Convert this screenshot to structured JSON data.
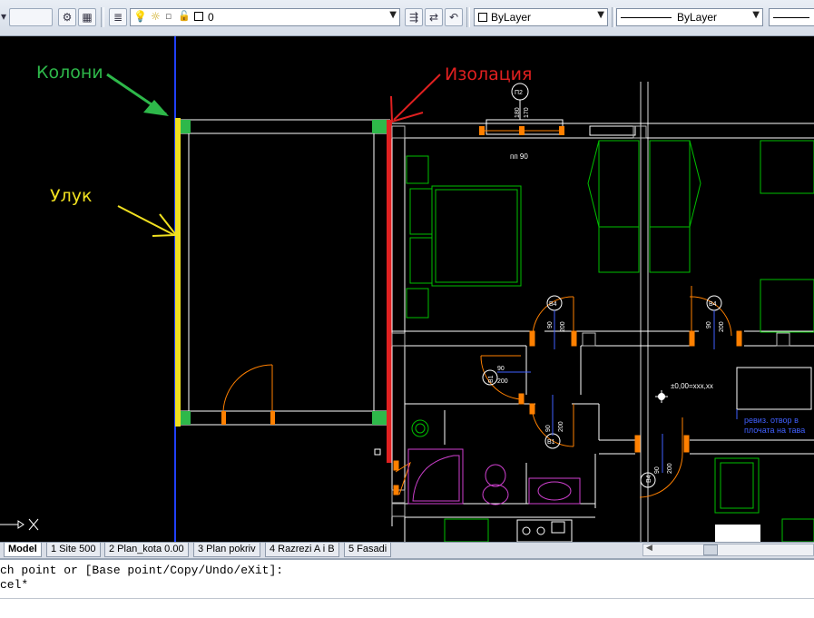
{
  "toolbar": {
    "layer_name": "0",
    "color_value": "ByLayer",
    "linetype_value": "ByLayer"
  },
  "annotations": {
    "columns_label": "Колони",
    "insulation_label": "Изолация",
    "rail_label": "Улук"
  },
  "drawing_labels": {
    "p2_tag": "П2",
    "p2_dim_a": "180",
    "p2_dim_b": "170",
    "pp_label": "пп 90",
    "b4_tag_1": "В4",
    "b4_dims_1": "90",
    "b4_dims_1b": "200",
    "b4_tag_2": "В4",
    "b4_dims_2": "90",
    "b4_dims_2b": "200",
    "b1_tag_1": "В1",
    "b1_dim_1": "90",
    "b1_dim_1b": "200",
    "b1_tag_2": "В1",
    "b1_dim_2": "90",
    "b1_dim_2b": "200",
    "b4_tag_3": "В4",
    "b4_dim_3": "90",
    "b4_dim_3b": "200",
    "level_label": "±0,00=xxx,xx",
    "note_line_1": "ревиз. отвор в",
    "note_line_2": "плочата на тава"
  },
  "tabs": [
    {
      "label": "Model",
      "active": true
    },
    {
      "label": "1 Site 500",
      "active": false
    },
    {
      "label": "2 Plan_kota 0.00",
      "active": false
    },
    {
      "label": "3 Plan pokriv",
      "active": false
    },
    {
      "label": "4 Razrezi A i B",
      "active": false
    },
    {
      "label": "5 Fasadi",
      "active": false
    }
  ],
  "command_line": {
    "line1": "ch point or [Base point/Copy/Undo/eXit]:",
    "line2": "cel*"
  },
  "colors": {
    "columns": "#2eb84a",
    "insulation": "#e02020",
    "rail": "#f0e020",
    "walls": "#ffffff",
    "furniture": "#00c000",
    "doors": "#ff8000",
    "sanitary": "#d040d0",
    "axis": "#2040ff"
  }
}
